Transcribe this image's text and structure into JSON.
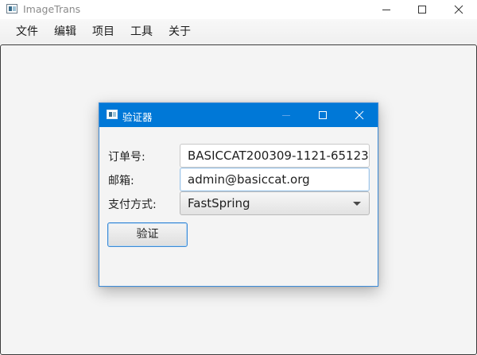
{
  "window": {
    "title": "ImageTrans"
  },
  "menu": {
    "items": [
      "文件",
      "编辑",
      "项目",
      "工具",
      "关于"
    ]
  },
  "dialog": {
    "title": "验证器",
    "order_label": "订单号:",
    "order_value": "BASICCAT200309-1121-65123",
    "email_label": "邮箱:",
    "email_value": "admin@basiccat.org",
    "payment_label": "支付方式:",
    "payment_value": "FastSpring",
    "verify_label": "验证"
  },
  "colors": {
    "dialog_titlebar": "#0078d7",
    "focus_border": "#3b8ad6",
    "content_bg": "#f4f4f4"
  },
  "icons": {
    "app": "app-icon",
    "minimize": "minimize-icon",
    "maximize": "maximize-icon",
    "close": "close-icon",
    "dropdown": "chevron-down-icon"
  }
}
